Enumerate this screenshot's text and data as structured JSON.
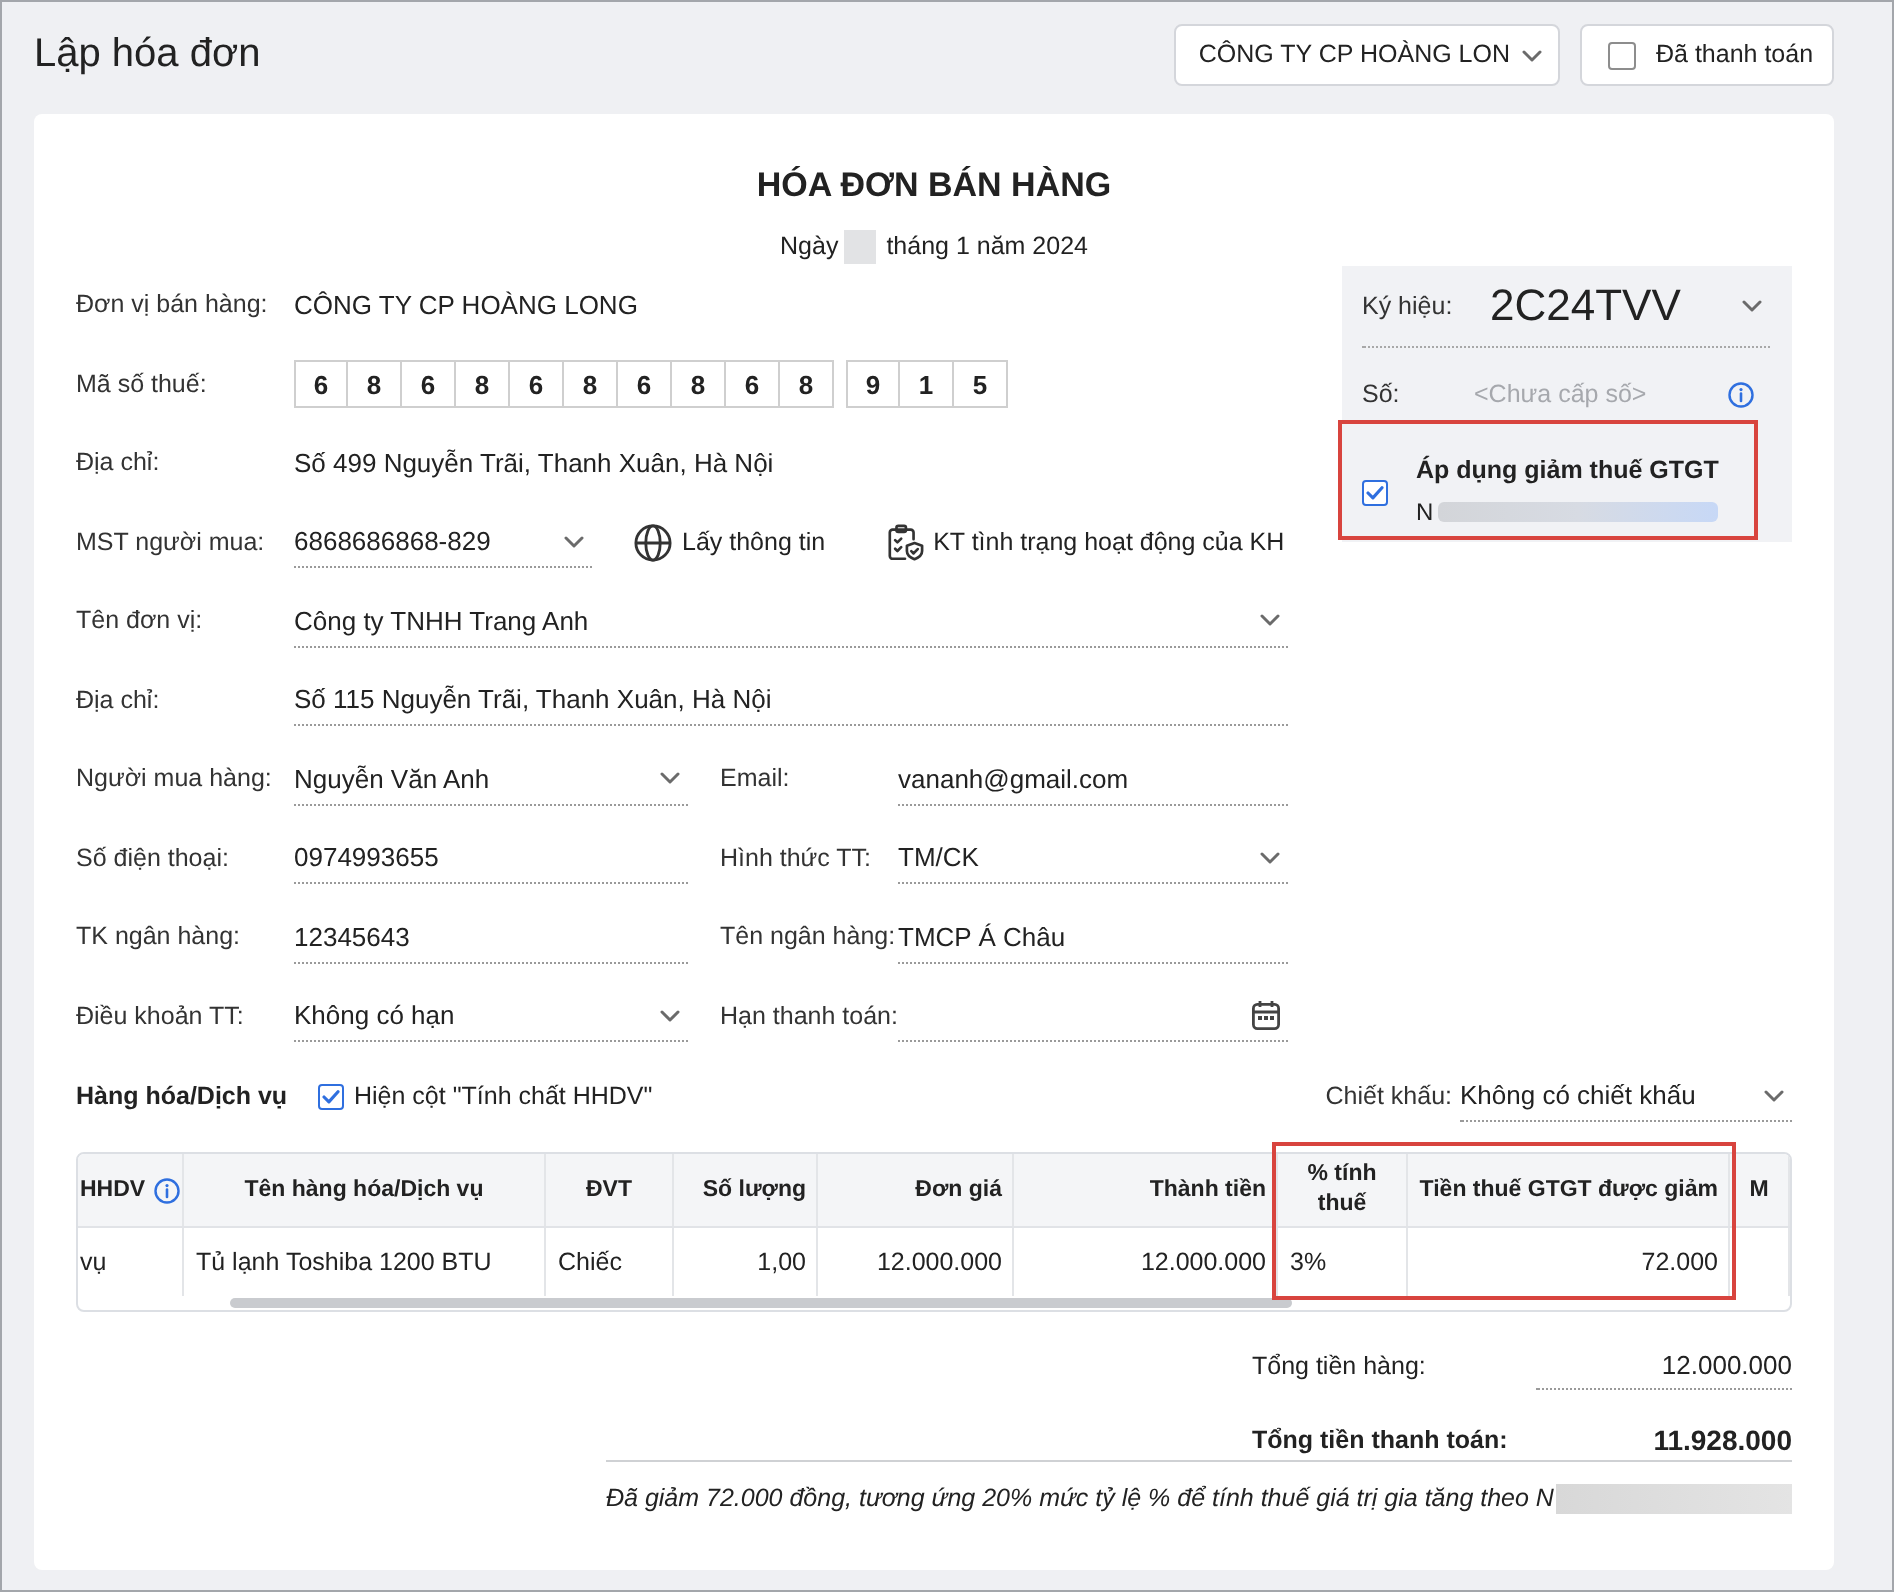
{
  "header": {
    "title": "Lập hóa đơn",
    "company_select": {
      "value": "CÔNG TY CP HOÀNG LON"
    },
    "paid": {
      "label": "Đã thanh toán",
      "checked": false
    }
  },
  "invoice": {
    "title": "HÓA ĐƠN BÁN HÀNG",
    "date_prefix": "Ngày",
    "date_rest": "tháng 1 năm 2024"
  },
  "seller": {
    "name": {
      "label": "Đơn vị bán hàng:",
      "value": "CÔNG TY CP HOÀNG LONG"
    },
    "tax_code": {
      "label": "Mã số thuế:",
      "digits": [
        "6",
        "8",
        "6",
        "8",
        "6",
        "8",
        "6",
        "8",
        "6",
        "8"
      ],
      "branch_digits": [
        "9",
        "1",
        "5"
      ]
    },
    "address": {
      "label": "Địa chỉ:",
      "value": "Số 499 Nguyễn Trãi, Thanh Xuân, Hà Nội"
    }
  },
  "buyer": {
    "tax_code": {
      "label": "MST người mua:",
      "value": "6868686868-829",
      "kind": "select"
    },
    "actions": [
      {
        "label": "Lấy thông tin"
      },
      {
        "label": "KT tình trạng hoạt động của KH"
      }
    ],
    "rows": [
      {
        "fields": [
          {
            "label": "Tên đơn vị:",
            "value": "Công ty TNHH Trang Anh",
            "kind": "select"
          }
        ]
      },
      {
        "fields": [
          {
            "label": "Địa chỉ:",
            "value": "Số 115 Nguyễn Trãi, Thanh Xuân, Hà Nội",
            "kind": "input"
          }
        ]
      },
      {
        "fields": [
          {
            "label": "Người mua hàng:",
            "value": "Nguyễn Văn Anh",
            "kind": "select"
          },
          {
            "label": "Email:",
            "value": "vananh@gmail.com",
            "kind": "input"
          }
        ]
      },
      {
        "fields": [
          {
            "label": "Số điện thoại:",
            "value": "0974993655",
            "kind": "input"
          },
          {
            "label": "Hình thức TT:",
            "value": "TM/CK",
            "kind": "select"
          }
        ]
      },
      {
        "fields": [
          {
            "label": "TK ngân hàng:",
            "value": "12345643",
            "kind": "input"
          },
          {
            "label": "Tên ngân hàng:",
            "value": "TMCP Á Châu",
            "kind": "input"
          }
        ]
      },
      {
        "fields": [
          {
            "label": "Điều khoản TT:",
            "value": "Không có hạn",
            "kind": "select"
          },
          {
            "label": "Hạn thanh toán:",
            "kind": "date"
          }
        ]
      }
    ]
  },
  "symbol_panel": {
    "symbol": {
      "label": "Ký hiệu:",
      "value": "2C24TVV"
    },
    "number": {
      "label": "Số:",
      "placeholder": "<Chưa cấp số>"
    },
    "vat_reduction": {
      "label": "Áp dụng giảm thuế GTGT",
      "checked": true,
      "note": "N",
      "highlighted": true
    }
  },
  "goods": {
    "title": "Hàng hóa/Dịch vụ",
    "show_nature_column": {
      "label": "Hiện cột \"Tính chất HHDV\"",
      "checked": true
    },
    "discount": {
      "label": "Chiết khấu:",
      "value": "Không có chiết khấu"
    }
  },
  "table": {
    "columns": [
      {
        "label": "HHDV",
        "kind": "info",
        "highlighted": false
      },
      {
        "label": "Tên hàng hóa/Dịch vụ",
        "kind": "text",
        "highlighted": false
      },
      {
        "label": "ĐVT",
        "kind": "text",
        "highlighted": false
      },
      {
        "label": "Số lượng",
        "kind": "number",
        "highlighted": false
      },
      {
        "label": "Đơn giá",
        "kind": "number",
        "highlighted": false
      },
      {
        "label": "Thành tiền",
        "kind": "number",
        "highlighted": false
      },
      {
        "label": "% tính thuế",
        "kind": "text",
        "highlighted": true
      },
      {
        "label": "Tiền thuế GTGT được giảm",
        "kind": "number",
        "highlighted": true
      },
      {
        "label": "M",
        "kind": "text",
        "highlighted": false
      }
    ],
    "rows": [
      {
        "cells": [
          "vụ",
          "Tủ lạnh Toshiba 1200 BTU",
          "Chiếc",
          "1,00",
          "12.000.000",
          "12.000.000",
          "3%",
          "72.000"
        ]
      }
    ]
  },
  "totals": [
    {
      "label": "Tổng tiền hàng:",
      "value": "12.000.000",
      "kind": "subtotal"
    },
    {
      "label": "Tổng tiền thanh toán:",
      "value": "11.928.000",
      "kind": "grand"
    }
  ],
  "note": "Đã giảm 72.000 đồng, tương ứng 20% mức tỷ lệ % để tính thuế giá trị gia tăng theo N"
}
